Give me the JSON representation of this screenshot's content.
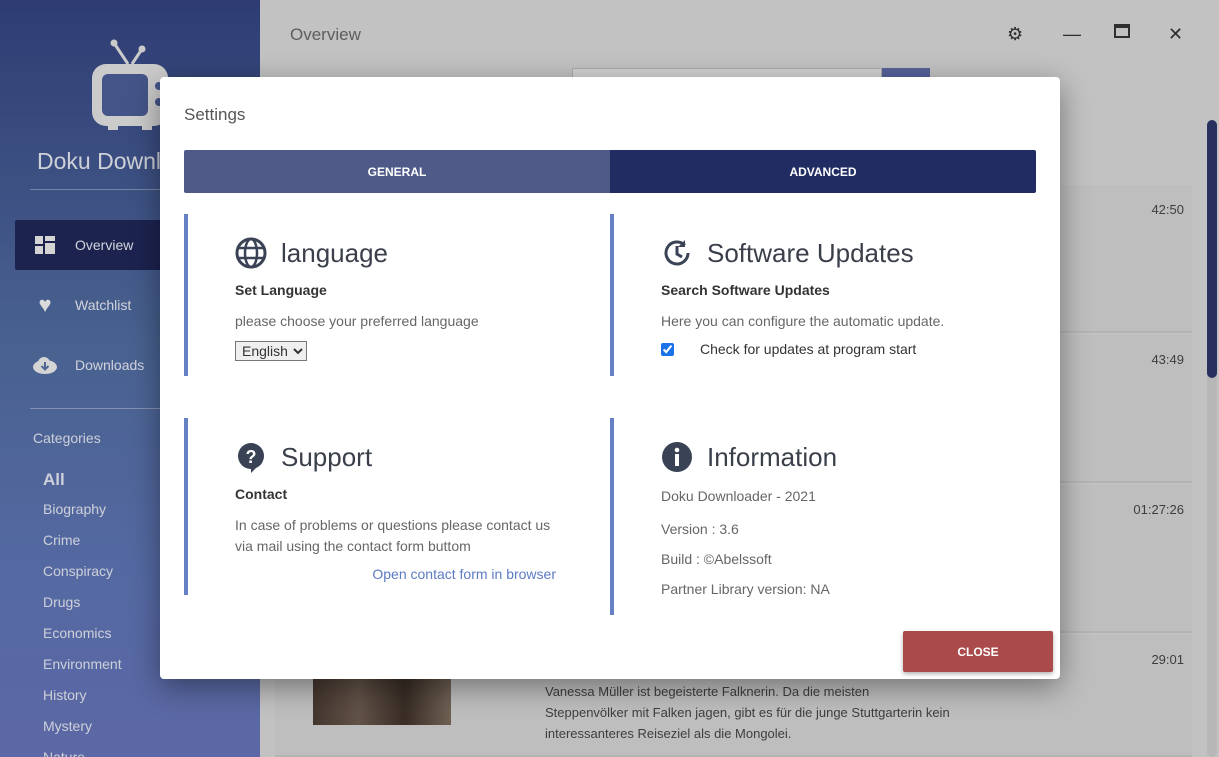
{
  "app": {
    "brand": "Doku Downloader",
    "page_title": "Overview"
  },
  "sidebar": {
    "nav": [
      {
        "label": "Overview",
        "icon": "dashboard-icon",
        "active": true
      },
      {
        "label": "Watchlist",
        "icon": "heart-icon"
      },
      {
        "label": "Downloads",
        "icon": "cloud-download-icon"
      }
    ],
    "categories_title": "Categories",
    "categories": [
      "All",
      "Biography",
      "Crime",
      "Conspiracy",
      "Drugs",
      "Economics",
      "Environment",
      "History",
      "Mystery",
      "Nature"
    ]
  },
  "cards": [
    {
      "duration": "42:50",
      "description": ""
    },
    {
      "duration": "43:49",
      "description": ""
    },
    {
      "duration": "01:27:26",
      "description": ""
    },
    {
      "duration": "29:01",
      "description": "Vanessa Müller ist begeisterte Falknerin. Da die meisten Steppenvölker mit Falken jagen, gibt es für die junge Stuttgarterin kein interessanteres Reiseziel als die Mongolei."
    }
  ],
  "settings": {
    "title": "Settings",
    "tabs": {
      "general": "GENERAL",
      "advanced": "ADVANCED"
    },
    "language": {
      "heading": "language",
      "sub": "Set Language",
      "text": "please choose your preferred language",
      "selected": "English"
    },
    "updates": {
      "heading": "Software Updates",
      "sub": "Search Software Updates",
      "text": "Here you can configure the automatic update.",
      "checkbox": "Check for updates at program start",
      "checked": true
    },
    "support": {
      "heading": "Support",
      "sub": "Contact",
      "text": "In case of problems or questions please contact us via mail using the contact form buttom",
      "link": "Open contact form in browser"
    },
    "info": {
      "heading": "Information",
      "line1": "Doku Downloader - 2021",
      "line2": "Version : 3.6",
      "line3": "Build : ©Abelssoft",
      "line4": "Partner Library version: NA"
    },
    "close": "CLOSE"
  },
  "colors": {
    "accent": "#212c63",
    "close": "#ab4a4a",
    "border": "#6680c4"
  }
}
